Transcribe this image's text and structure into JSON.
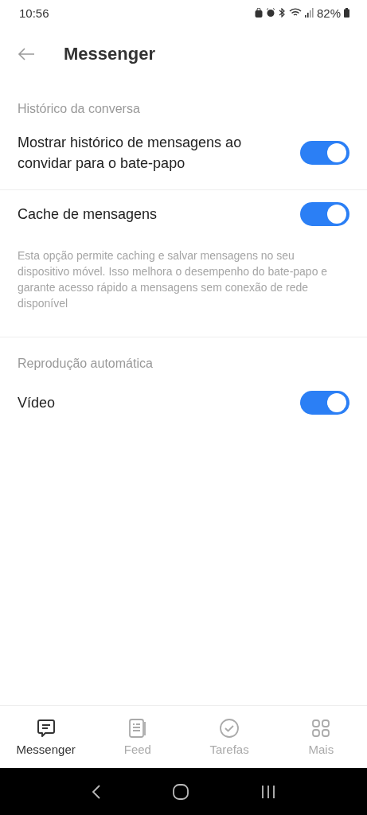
{
  "status_bar": {
    "time": "10:56",
    "battery": "82%"
  },
  "header": {
    "title": "Messenger"
  },
  "sections": [
    {
      "title": "Histórico da conversa",
      "items": [
        {
          "label": "Mostrar histórico de mensagens ao convidar para o bate-papo",
          "on": true
        },
        {
          "label": "Cache de mensagens",
          "on": true,
          "description": "Esta opção permite caching e salvar mensagens no seu dispositivo móvel. Isso melhora o desempenho do bate-papo e garante acesso rápido a mensagens sem conexão de rede disponível"
        }
      ]
    },
    {
      "title": "Reprodução automática",
      "items": [
        {
          "label": "Vídeo",
          "on": true
        }
      ]
    }
  ],
  "tabs": [
    {
      "label": "Messenger",
      "kind": "chat",
      "selected": true
    },
    {
      "label": "Feed",
      "kind": "feed",
      "selected": false
    },
    {
      "label": "Tarefas",
      "kind": "tasks",
      "selected": false
    },
    {
      "label": "Mais",
      "kind": "more",
      "selected": false
    }
  ]
}
